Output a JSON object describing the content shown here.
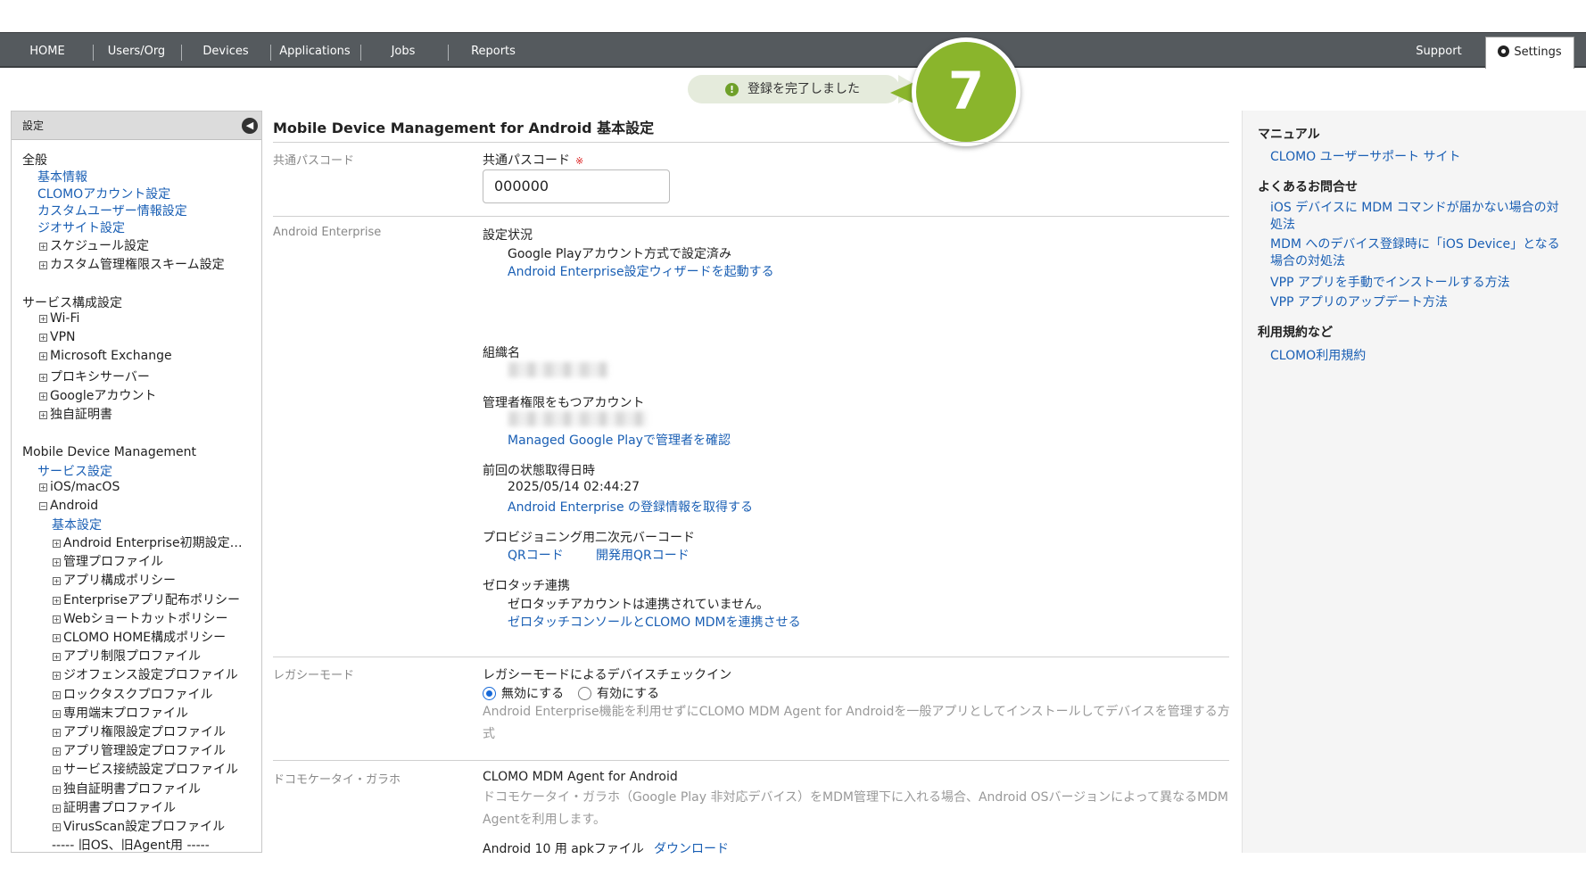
{
  "nav": {
    "home": "HOME",
    "users": "Users/Org",
    "devices": "Devices",
    "applications": "Applications",
    "jobs": "Jobs",
    "reports": "Reports",
    "support": "Support",
    "settings": "Settings"
  },
  "toast": {
    "message": "登録を完了しました",
    "step": "7"
  },
  "sidebar": {
    "header": "設定",
    "general": "全般",
    "basic_info": "基本情報",
    "clomo_account": "CLOMOアカウント設定",
    "custom_user": "カスタムユーザー情報設定",
    "geosite": "ジオサイト設定",
    "schedule": "スケジュール設定",
    "custom_perm": "カスタム管理権限スキーム設定",
    "service_config": "サービス構成設定",
    "wifi": "Wi-Fi",
    "vpn": "VPN",
    "exchange": "Microsoft Exchange",
    "proxy": "プロキシサーバー",
    "google_acct": "Googleアカウント",
    "own_cert": "独自証明書",
    "mdm": "Mobile Device Management",
    "service_settings": "サービス設定",
    "ios": "iOS/macOS",
    "android": "Android",
    "android_basic": "基本設定",
    "android_items": [
      "Android Enterprise初期設定…",
      "管理プロファイル",
      "アプリ構成ポリシー",
      "Enterpriseアプリ配布ポリシー",
      "Webショートカットポリシー",
      "CLOMO HOME構成ポリシー",
      "アプリ制限プロファイル",
      "ジオフェンス設定プロファイル",
      "ロックタスクプロファイル",
      "専用端末プロファイル",
      "アプリ権限設定プロファイル",
      "アプリ管理設定プロファイル",
      "サービス接続設定プロファイル",
      "独自証明書プロファイル",
      "証明書プロファイル",
      "VirusScan設定プロファイル"
    ],
    "old_os": "----- 旧OS、旧Agent用 -----"
  },
  "main": {
    "title": "Mobile Device Management for Android 基本設定",
    "passcode_section": "共通パスコード",
    "passcode_label": "共通パスコード",
    "passcode_required": "※",
    "passcode_value": "000000",
    "ae_section": "Android Enterprise",
    "status_label": "設定状況",
    "status_value": "Google Playアカウント方式で設定済み",
    "wizard_link": "Android Enterprise設定ウィザードを起動する",
    "org_label": "組織名",
    "admin_label": "管理者権限をもつアカウント",
    "admin_link": "Managed Google Playで管理者を確認",
    "last_status_label": "前回の状態取得日時",
    "last_status_value": "2025/05/14 02:44:27",
    "fetch_link": "Android Enterprise の登録情報を取得する",
    "qr_label": "プロビジョニング用二次元バーコード",
    "qr_link": "QRコード",
    "dev_qr_link": "開発用QRコード",
    "zero_label": "ゼロタッチ連携",
    "zero_value": "ゼロタッチアカウントは連携されていません。",
    "zero_link": "ゼロタッチコンソールとCLOMO MDMを連携させる",
    "legacy_section": "レガシーモード",
    "legacy_label": "レガシーモードによるデバイスチェックイン",
    "legacy_disable": "無効にする",
    "legacy_enable": "有効にする",
    "legacy_desc": "Android Enterprise機能を利用せずにCLOMO MDM Agent for Androidを一般アプリとしてインストールしてデバイスを管理する方式",
    "docomo_section": "ドコモケータイ・ガラホ",
    "agent_label": "CLOMO MDM Agent for Android",
    "agent_desc": "ドコモケータイ・ガラホ（Google Play 非対応デバイス）をMDM管理下に入れる場合、Android OSバージョンによって異なるMDM Agentを利用します。",
    "apk_label": "Android 10 用 apkファイル",
    "apk_link": "ダウンロード"
  },
  "right": {
    "manual_head": "マニュアル",
    "manual_link": "CLOMO ユーザーサポート サイト",
    "faq_head": "よくあるお問合せ",
    "faq1": "iOS デバイスに MDM コマンドが届かない場合の対処法",
    "faq2": "MDM へのデバイス登録時に「iOS Device」となる場合の対処法",
    "faq3": "VPP アプリを手動でインストールする方法",
    "faq4": "VPP アプリのアップデート方法",
    "terms_head": "利用規約など",
    "terms_link": "CLOMO利用規約"
  }
}
